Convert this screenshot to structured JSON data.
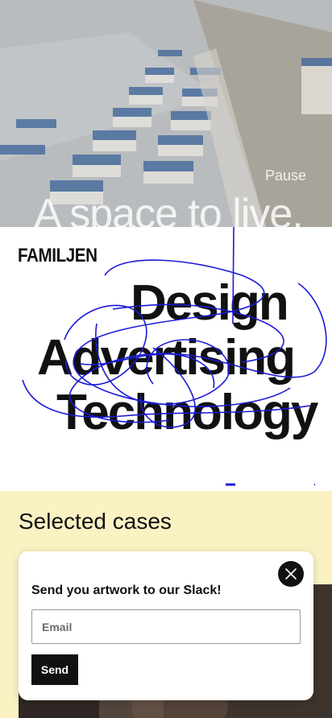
{
  "hero": {
    "pause_label": "Pause",
    "headline": "A space to live."
  },
  "brand": {
    "logo": "FAMILJEN",
    "disciplines": [
      "Design",
      "Advertising",
      "Technology"
    ],
    "scribble_color": "#1a1ad6"
  },
  "cases": {
    "title": "Selected cases",
    "background": "#fbf2c4"
  },
  "popup": {
    "title": "Send you artwork to our Slack!",
    "email_placeholder": "Email",
    "email_value": "",
    "send_label": "Send",
    "close_icon": "close-icon"
  }
}
